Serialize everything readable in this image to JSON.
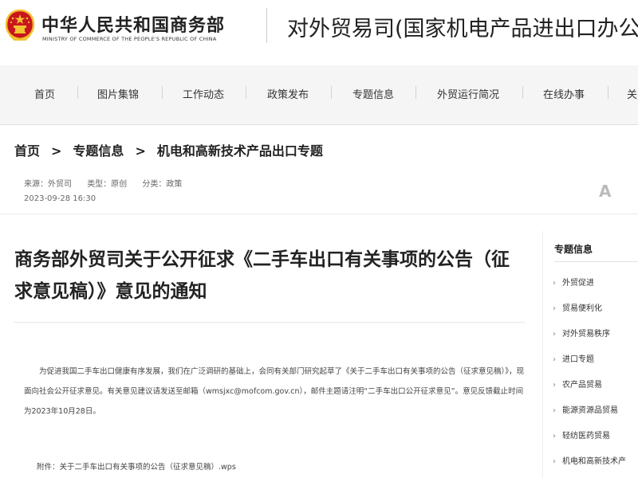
{
  "header": {
    "ministry_cn": "中华人民共和国商务部",
    "ministry_en": "MINISTRY OF COMMERCE OF THE PEOPLE'S REPUBLIC OF CHINA",
    "dept_title": "对外贸易司(国家机电产品进出口办公"
  },
  "nav": {
    "items": [
      "首页",
      "图片集锦",
      "工作动态",
      "政策发布",
      "专题信息",
      "外贸运行简况",
      "在线办事",
      "关"
    ]
  },
  "breadcrumb": {
    "items": [
      "首页",
      "专题信息",
      "机电和高新技术产品出口专题"
    ],
    "separator": ">"
  },
  "meta": {
    "source": "来源：外贸司",
    "type": "类型：原创",
    "category": "分类：政策",
    "date": "2023-09-28 16:30",
    "font_size_label": "A"
  },
  "article": {
    "title": "商务部外贸司关于公开征求《二手车出口有关事项的公告（征求意见稿）》意见的通知",
    "body": "为促进我国二手车出口健康有序发展，我们在广泛调研的基础上，会同有关部门研究起草了《关于二手车出口有关事项的公告（征求意见稿）》，现面向社会公开征求意见。有关意见建议请发送至邮箱（wmsjxc@mofcom.gov.cn），邮件主题请注明“二手车出口公开征求意见”。意见反馈截止时间为2023年10月28日。",
    "attachment": "附件：关于二手车出口有关事项的公告（征求意见稿）.wps"
  },
  "sidebar": {
    "title": "专题信息",
    "items": [
      "外贸促进",
      "贸易便利化",
      "对外贸易秩序",
      "进口专题",
      "农产品贸易",
      "能源资源品贸易",
      "轻纺医药贸易",
      "机电和高新技术产"
    ]
  },
  "colors": {
    "emblem_red": "#c8161d",
    "emblem_gold": "#f2c230",
    "nav_bg": "#f5f5f5"
  }
}
